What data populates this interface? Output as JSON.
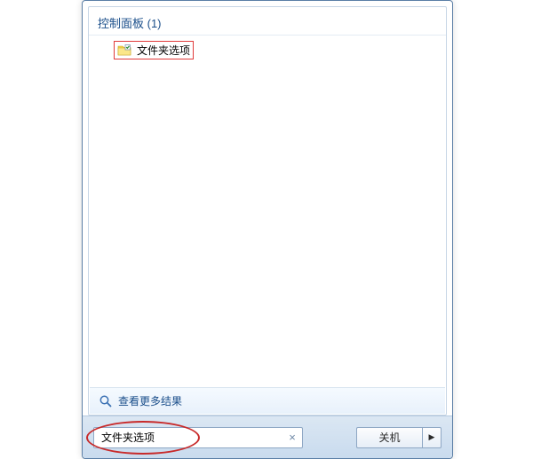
{
  "results": {
    "category_header": "控制面板 (1)",
    "items": [
      {
        "label": "文件夹选项"
      }
    ],
    "see_more_label": "查看更多结果"
  },
  "search": {
    "value": "文件夹选项",
    "clear_glyph": "×"
  },
  "shutdown": {
    "label": "关机",
    "arrow_glyph": "▶"
  }
}
